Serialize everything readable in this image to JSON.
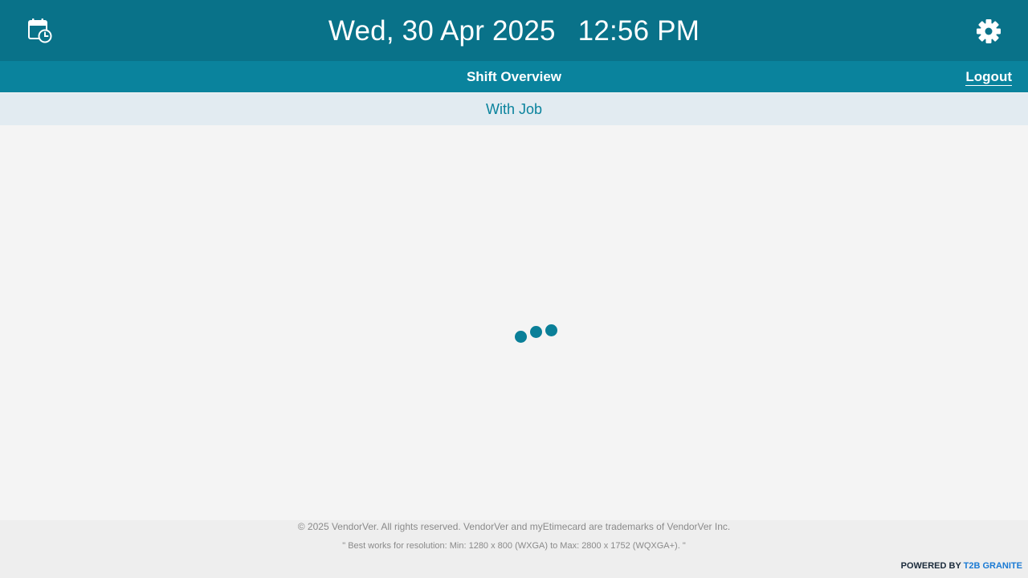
{
  "header": {
    "date": "Wed, 30 Apr 2025",
    "time": "12:56 PM",
    "left_icon": "calendar-clock-icon",
    "right_icon": "gear-icon",
    "background_color": "#097289"
  },
  "nav": {
    "title": "Shift Overview",
    "logout_label": "Logout",
    "background_color": "#0a839d"
  },
  "subheader": {
    "title": "With Job"
  },
  "main": {
    "loading_indicator": "loading-dots"
  },
  "footer": {
    "copyright": "© 2025 VendorVer. All rights reserved. VendorVer and myEtimecard are trademarks of VendorVer Inc.",
    "resolution_note": "\" Best works for resolution: Min: 1280 x 800 (WXGA) to Max: 2800 x 1752 (WQXGA+). \"",
    "powered_by_label": "POWERED BY",
    "powered_by_brand": "T2B GRANITE"
  }
}
